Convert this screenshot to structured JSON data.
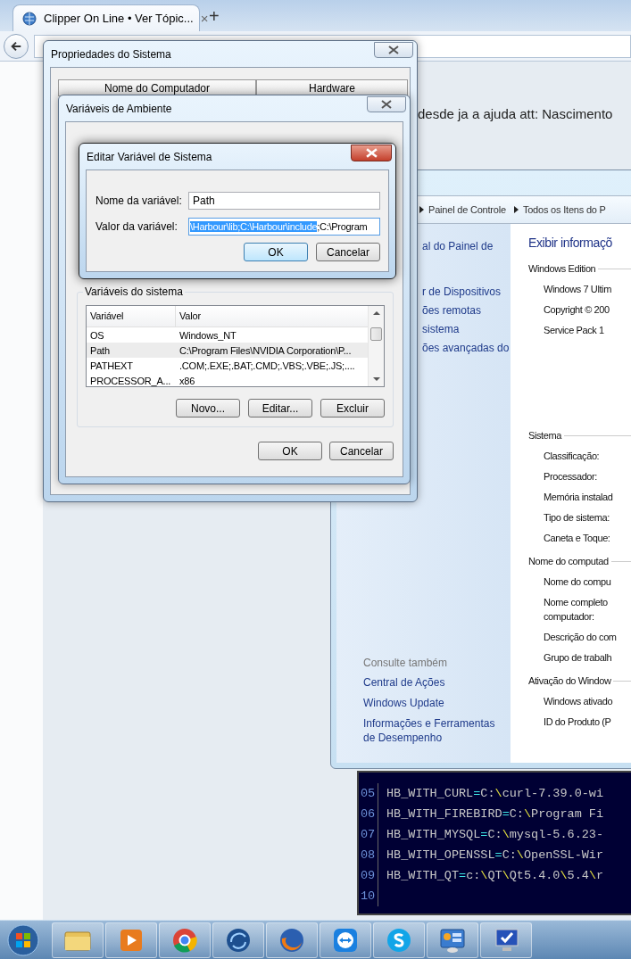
{
  "browser": {
    "tab_title": "Clipper On Line • Ver Tópic...",
    "tab_close": "×",
    "new_tab": "+"
  },
  "forum_text": "desde ja a ajuda att: Nascimento",
  "control_panel": {
    "breadcrumb": [
      "Painel de Controle",
      "Todos os Itens do P"
    ],
    "sidebar_links": [
      "al do Painel de",
      "r de Dispositivos",
      "ões remotas",
      "sistema",
      "ões avançadas do"
    ],
    "see_also_title": "Consulte também",
    "see_also_links": [
      "Central de Ações",
      "Windows Update",
      "Informações e Ferramentas de Desempenho"
    ],
    "heading": "Exibir informaçõ",
    "sections": [
      {
        "title": "Windows Edition",
        "items": [
          "Windows 7 Ultim",
          "Copyright © 200",
          "Service Pack 1"
        ]
      },
      {
        "title": "Sistema",
        "items": [
          "Classificação:",
          "Processador:",
          "Memória instalad",
          "Tipo de sistema:",
          "Caneta e Toque:"
        ]
      },
      {
        "title": "Nome do computad",
        "items": [
          "Nome do compu",
          "Nome completo\ncomputador:",
          "Descrição do com",
          "Grupo de trabalh"
        ]
      },
      {
        "title": "Ativação do Window",
        "items": [
          "Windows ativado",
          "ID do Produto (P"
        ]
      }
    ]
  },
  "code_editor": {
    "lines": [
      {
        "number": "05",
        "text": "HB_WITH_CURL=C:\\curl-7.39.0-wi"
      },
      {
        "number": "06",
        "text": "HB_WITH_FIREBIRD=C:\\Program Fi"
      },
      {
        "number": "07",
        "text": "HB_WITH_MYSQL=C:\\mysql-5.6.23-"
      },
      {
        "number": "08",
        "text": "HB_WITH_OPENSSL=C:\\OpenSSL-Wir"
      },
      {
        "number": "09",
        "text": "HB_WITH_QT=c:\\QT\\Qt5.4.0\\5.4\\r"
      },
      {
        "number": "10"
      }
    ]
  },
  "system_properties": {
    "title": "Propriedades do Sistema",
    "tabs": [
      "Nome do Computador",
      "Hardware"
    ]
  },
  "environment_variables": {
    "title": "Variáveis de Ambiente",
    "group_title": "Variáveis do sistema",
    "columns": [
      "Variável",
      "Valor"
    ],
    "rows": [
      {
        "name": "OS",
        "value": "Windows_NT",
        "selected": false
      },
      {
        "name": "Path",
        "value": "C:\\Program Files\\NVIDIA Corporation\\P...",
        "selected": true
      },
      {
        "name": "PATHEXT",
        "value": ".COM;.EXE;.BAT;.CMD;.VBS;.VBE;.JS;....",
        "selected": false
      },
      {
        "name": "PROCESSOR_A...",
        "value": "x86",
        "selected": false
      }
    ],
    "list_buttons": [
      "Novo...",
      "Editar...",
      "Excluir"
    ],
    "buttons": [
      "OK",
      "Cancelar"
    ]
  },
  "edit_dialog": {
    "title": "Editar Variável de Sistema",
    "name_label": "Nome da variável:",
    "name_value": "Path",
    "value_label": "Valor da variável:",
    "value_parts": [
      {
        "text": "\\Harbour\\lib;C:\\Harbour\\include",
        "selected": true
      },
      {
        "text": ";C:\\Program",
        "selected": false
      }
    ],
    "buttons": [
      {
        "label": "OK",
        "default": true
      },
      {
        "label": "Cancelar",
        "default": false
      }
    ]
  }
}
